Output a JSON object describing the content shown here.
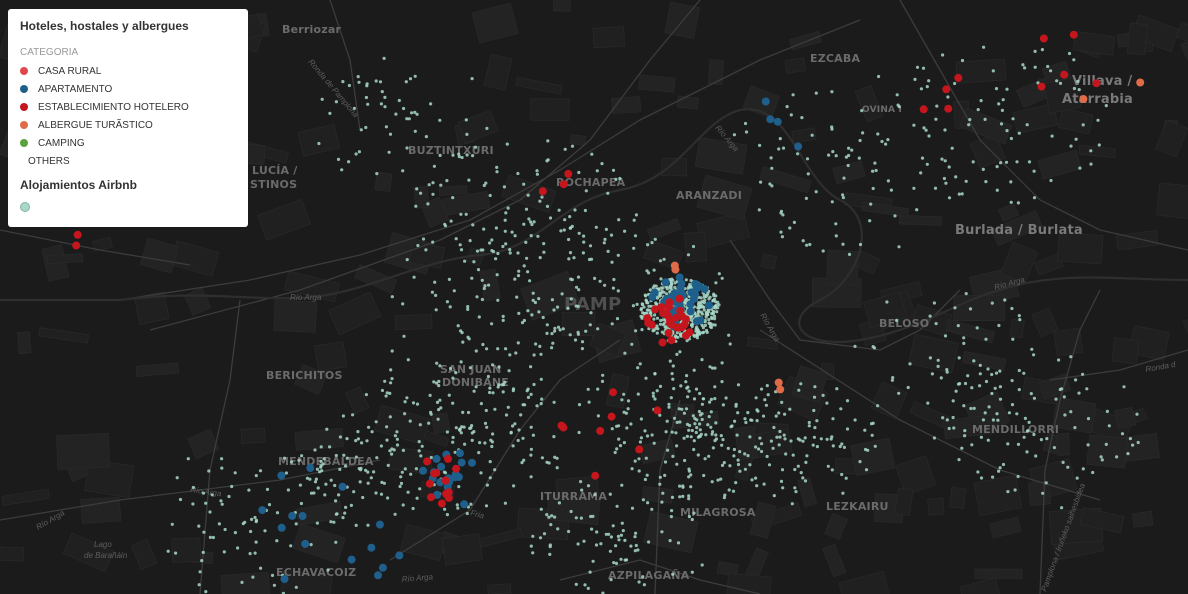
{
  "legend": {
    "title": "Hoteles, hostales y albergues",
    "subtitle": "CATEGORIA",
    "categories": [
      {
        "label": "CASA RURAL",
        "color": "#e0494d"
      },
      {
        "label": "APARTAMENTO",
        "color": "#1f5f8b"
      },
      {
        "label": "ESTABLECIMIENTO HOTELERO",
        "color": "#c4161c"
      },
      {
        "label": "ALBERGUE TURÃSTICO",
        "color": "#e06b48"
      },
      {
        "label": "CAMPING",
        "color": "#5aa33a"
      },
      {
        "label": "OTHERS",
        "color": ""
      }
    ],
    "airbnb_title": "Alojamientos Airbnb",
    "airbnb_color": "#a8d8c8"
  },
  "map": {
    "districts": {
      "berriozar": "Berriozar",
      "ezcaba": "EZCABA",
      "villava": "Villava /",
      "atarrabia": "Atarrabia",
      "ovina": "OVINA I",
      "buztintxuri": "BUZTINTXURI",
      "rochapea": "ROCHAPEA",
      "aranzadi": "ARANZADI",
      "santa_lucia": "LUCÍA /",
      "santa_lucia2": "STINOS",
      "burlada": "Burlada / Burlata",
      "pamplona": "PAMP",
      "beloso": "BELOSO",
      "berichitos": "BERICHITOS",
      "sanjuan": "SAN JUAN",
      "donibane": "DONIBANE",
      "mendillorri": "MENDILLORRI",
      "mendebaldea": "MENDEBALDEA",
      "iturrama": "ITURRAMA",
      "milagrosa": "MILAGROSA",
      "lezkairu": "LEZKAIRU",
      "echavacoiz": "ECHAVACOIZ",
      "azpilagana": "AZPILAGAÑA",
      "lago": "Lago",
      "lago2": "de Barañáin"
    },
    "roads": {
      "rio_arga_1": "Río Arga",
      "rio_arga_2": "Río Arga",
      "rio_arga_3": "Río Arga",
      "rio_arga_4": "Río Arga",
      "rio_arga_5": "Río Arga",
      "rio_arga_6": "Río Arga",
      "rio_arga_7": "Río Arga",
      "ronda": "Ronda d",
      "pamplona_irunea": "Pamplona / Iruñeko saihesbidea",
      "ronda_pamplona": "Ronda de Pamplona",
      "fria": "Fria"
    }
  }
}
